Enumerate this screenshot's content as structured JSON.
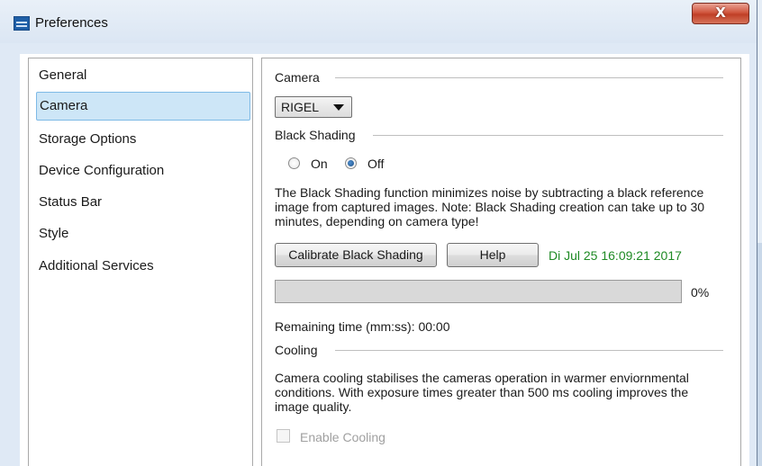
{
  "window": {
    "title": "Preferences",
    "close_glyph": "X"
  },
  "sidebar": {
    "items": [
      {
        "label": "General"
      },
      {
        "label": "Camera",
        "selected": true
      },
      {
        "label": "Storage Options"
      },
      {
        "label": "Device Configuration"
      },
      {
        "label": "Status Bar"
      },
      {
        "label": "Style"
      },
      {
        "label": "Additional Services"
      }
    ]
  },
  "camera": {
    "section_title": "Camera",
    "selected_camera": "RIGEL"
  },
  "black_shading": {
    "section_title": "Black Shading",
    "on_label": "On",
    "off_label": "Off",
    "selected": "Off",
    "description": "The Black Shading function minimizes noise by subtracting a black reference image from captured images. Note: Black Shading creation can take up to 30 minutes, depending on camera type!",
    "calibrate_label": "Calibrate Black Shading",
    "help_label": "Help",
    "timestamp": "Di Jul 25 16:09:21 2017",
    "progress_percent": 0,
    "progress_text": "0%",
    "remaining_time": "Remaining time (mm:ss):  00:00"
  },
  "cooling": {
    "section_title": "Cooling",
    "description": "Camera cooling stabilises the cameras operation in warmer enviornmental conditions. With exposure times greater than 500 ms cooling improves the image quality.",
    "enable_label": "Enable Cooling",
    "enabled": false,
    "checked": false
  },
  "colors": {
    "selection_bg": "#cde6f7",
    "timestamp": "#1e8a24",
    "close_button": "#c03f26"
  }
}
